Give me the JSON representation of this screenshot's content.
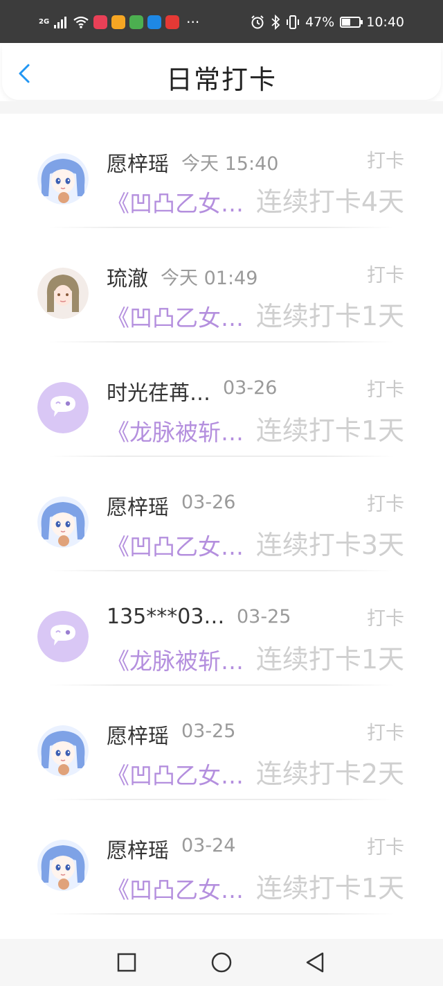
{
  "status_bar": {
    "network": "2G",
    "battery": "47%",
    "battery_level": 0.47,
    "time": "10:40",
    "more": "···",
    "app_icons": [
      {
        "name": "app-icon-1",
        "color": "#e94057"
      },
      {
        "name": "app-icon-2",
        "color": "#f6a623"
      },
      {
        "name": "app-icon-3",
        "color": "#4caf50"
      },
      {
        "name": "search-app-icon",
        "color": "#1e88e5"
      },
      {
        "name": "huawei-app-icon",
        "color": "#e53935"
      }
    ]
  },
  "header": {
    "title": "日常打卡"
  },
  "colors": {
    "accent": "#2196f3",
    "book": "#b48fde",
    "avatar_default": "#d9c7f5"
  },
  "items": [
    {
      "name": "愿梓瑶",
      "time": "今天 15:40",
      "action": "打卡",
      "book": "《凹凸乙女…",
      "streak": "连续打卡4天",
      "avatar": "anime-girl"
    },
    {
      "name": "琉澈",
      "time": "今天 01:49",
      "action": "打卡",
      "book": "《凹凸乙女…",
      "streak": "连续打卡1天",
      "avatar": "portrait"
    },
    {
      "name": "时光荏苒…",
      "time": "03-26",
      "action": "打卡",
      "book": "《龙脉被斩…",
      "streak": "连续打卡1天",
      "avatar": "default"
    },
    {
      "name": "愿梓瑶",
      "time": "03-26",
      "action": "打卡",
      "book": "《凹凸乙女…",
      "streak": "连续打卡3天",
      "avatar": "anime-girl"
    },
    {
      "name": "135***03…",
      "time": "03-25",
      "action": "打卡",
      "book": "《龙脉被斩…",
      "streak": "连续打卡1天",
      "avatar": "default"
    },
    {
      "name": "愿梓瑶",
      "time": "03-25",
      "action": "打卡",
      "book": "《凹凸乙女…",
      "streak": "连续打卡2天",
      "avatar": "anime-girl"
    },
    {
      "name": "愿梓瑶",
      "time": "03-24",
      "action": "打卡",
      "book": "《凹凸乙女…",
      "streak": "连续打卡1天",
      "avatar": "anime-girl"
    }
  ],
  "nav_bar": [
    "recent-apps",
    "home",
    "back"
  ]
}
